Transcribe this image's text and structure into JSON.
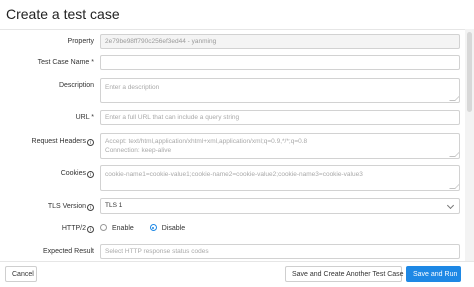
{
  "dialog": {
    "title": "Create a test case"
  },
  "form": {
    "property": {
      "label": "Property",
      "value": "2e79be98ff790c256ef3ed44 - yanming"
    },
    "test_case_name": {
      "label": "Test Case Name *",
      "value": ""
    },
    "description": {
      "label": "Description",
      "placeholder": "Enter a description"
    },
    "url": {
      "label": "URL *",
      "placeholder": "Enter a full URL that can include a query string"
    },
    "request_headers": {
      "label": "Request Headers",
      "placeholder_line1": "Accept: text/html,application/xhtml+xml,application/xml;q=0.9,*/*;q=0.8",
      "placeholder_line2": "Connection: keep-alive"
    },
    "cookies": {
      "label": "Cookies",
      "placeholder": "cookie-name1=cookie-value1;cookie-name2=cookie-value2;cookie-name3=cookie-value3"
    },
    "tls_version": {
      "label": "TLS Version",
      "value": "TLS 1"
    },
    "http2": {
      "label": "HTTP/2",
      "options": [
        {
          "label": "Enable",
          "selected": false
        },
        {
          "label": "Disable",
          "selected": true
        }
      ]
    },
    "expected_result": {
      "label": "Expected Result",
      "placeholder": "Select HTTP response status codes"
    }
  },
  "footer": {
    "cancel_label": "Cancel",
    "save_create_another_label": "Save and Create Another Test Case",
    "save_run_label": "Save and Run"
  },
  "colors": {
    "primary": "#1e88e5",
    "border": "#d2d2d2"
  },
  "icons": {
    "info": "info-circle-icon",
    "select": "chevron-down-icon"
  }
}
